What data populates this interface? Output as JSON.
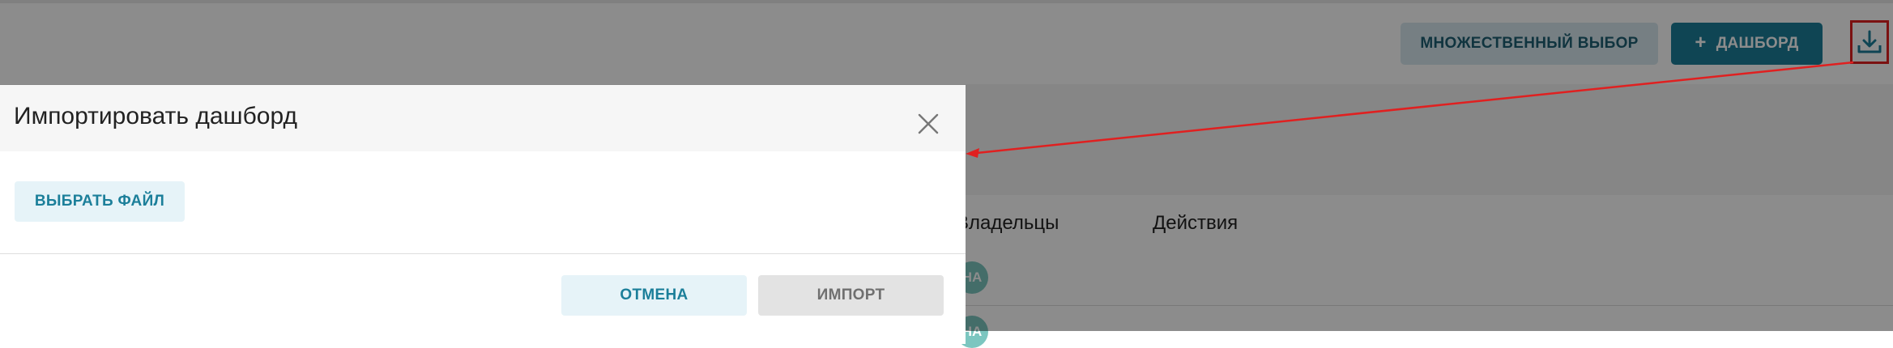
{
  "header": {
    "multi_select_label": "МНОЖЕСТВЕННЫЙ ВЫБОР",
    "add_dashboard_label": "ДАШБОРД",
    "download_icon": "download-icon"
  },
  "table": {
    "columns": [
      "Владельцы",
      "Действия"
    ],
    "owner_avatars": [
      "НА",
      "НА"
    ]
  },
  "modal": {
    "title": "Импортировать дашборд",
    "choose_file_label": "ВЫБРАТЬ ФАЙЛ",
    "cancel_label": "ОТМЕНА",
    "import_label": "ИМПОРТ",
    "close_icon": "close-icon"
  },
  "colors": {
    "accent": "#1c7f9a",
    "accent_light": "#e6f3f8",
    "annotation": "#e02020",
    "avatar": "#7cc6c0"
  }
}
